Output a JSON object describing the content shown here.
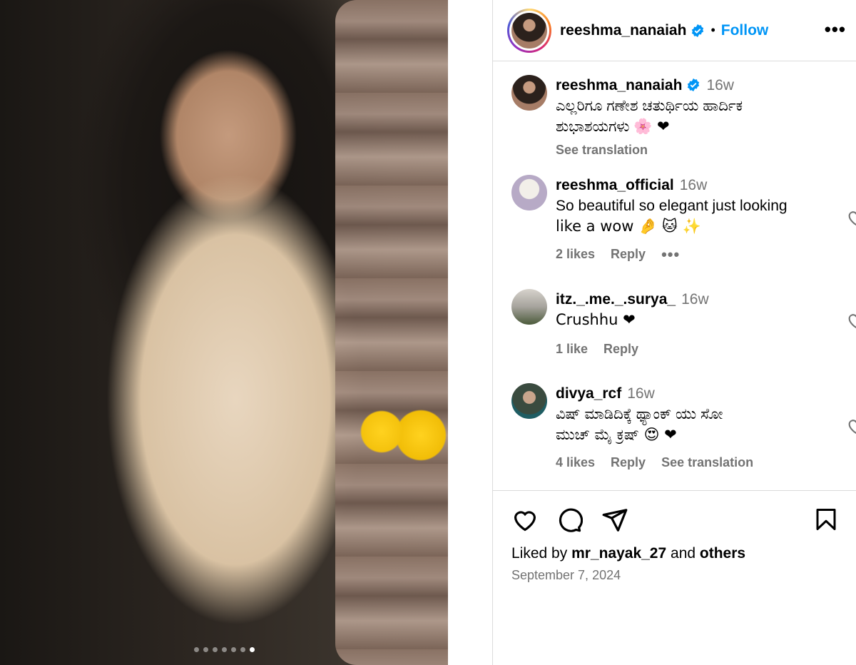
{
  "post": {
    "carousel_dots": 7,
    "active_dot": 7
  },
  "header": {
    "username": "reeshma_nanaiah",
    "separator": "•",
    "follow_label": "Follow",
    "more_icon": "more-horizontal-icon"
  },
  "caption": {
    "username": "reeshma_nanaiah",
    "time": "16w",
    "text_line1": "ಎಲ್ಲರಿಗೂ ಗಣೇಶ ಚತುರ್ಥಿಯ ಹಾರ್ದಿಕ",
    "text_line2": "ಶುಭಾಶಯಗಳು",
    "emoji": "🌸 ❤",
    "see_translation": "See translation"
  },
  "comments": [
    {
      "username": "reeshma_official",
      "time": "16w",
      "text_line1": "So beautiful so elegant just looking",
      "text_line2": "like a wow 🤌 🐱 ✨",
      "likes": "2 likes",
      "reply": "Reply",
      "more": "•••"
    },
    {
      "username": "itz._.me._.surya_",
      "time": "16w",
      "text_line1": "Crushhu ❤",
      "likes": "1 like",
      "reply": "Reply"
    },
    {
      "username": "divya_rcf",
      "time": "16w",
      "text_line1": "ವಿಷ್ ಮಾಡಿದಿಕ್ಕೆ ಥ್ಯಾಂಕ್ ಯು ಸೋ",
      "text_line2": "ಮುಚ್ ಮೈ ಕ್ರಷ್ 😍 ❤",
      "likes": "4 likes",
      "reply": "Reply",
      "see_translation": "See translation"
    }
  ],
  "footer": {
    "liked_prefix": "Liked by",
    "liked_user": "mr_nayak_27",
    "liked_and": "and",
    "liked_others": "others",
    "date": "September 7, 2024"
  },
  "colors": {
    "link_blue": "#0095f6",
    "muted": "#737373",
    "border": "#dbdbdb"
  }
}
